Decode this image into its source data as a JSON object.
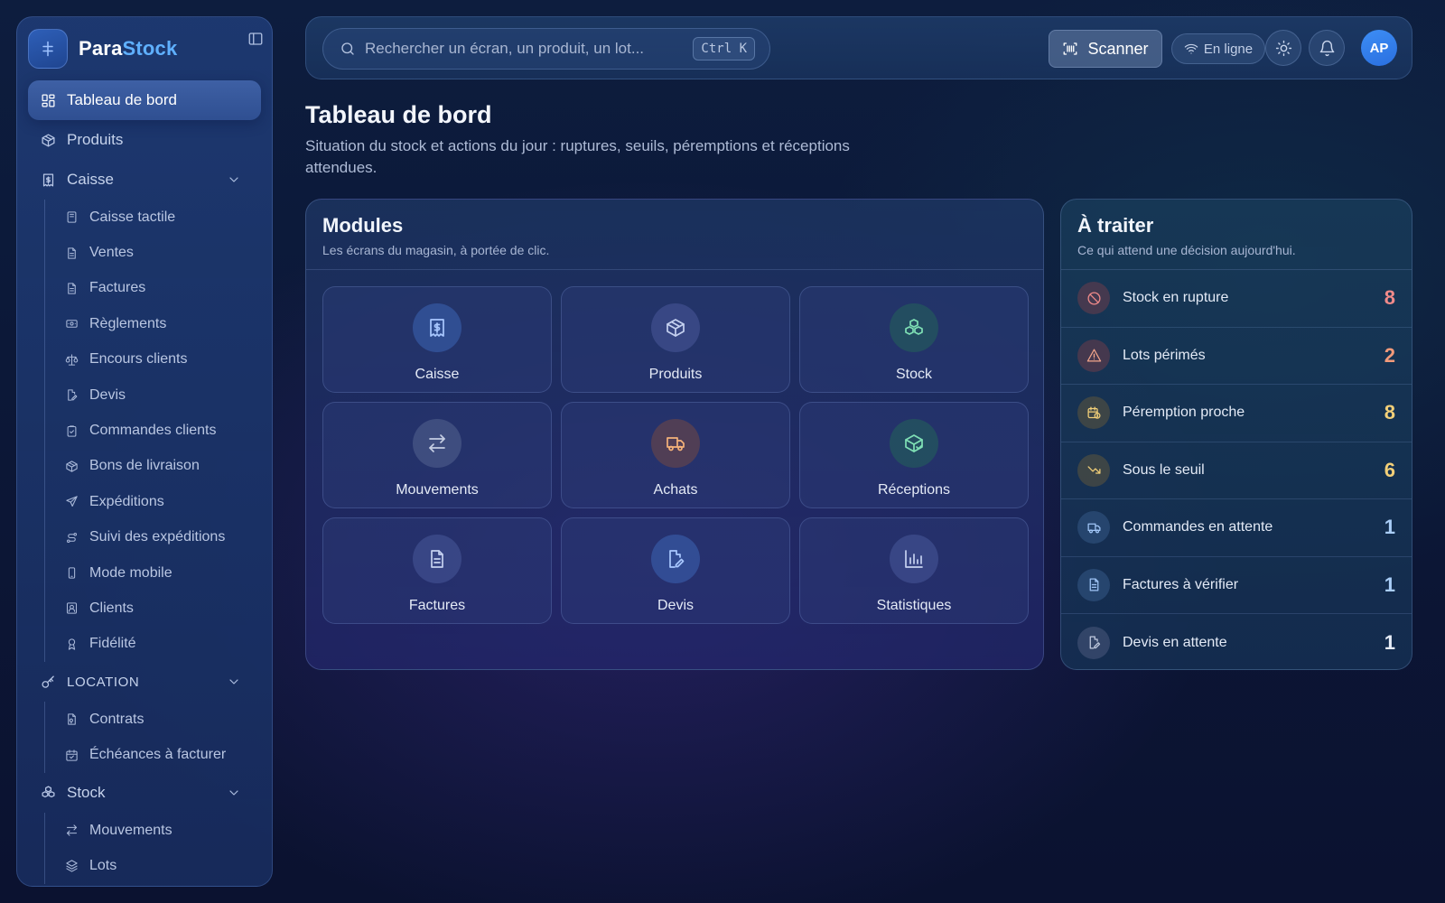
{
  "brand": {
    "name_part1": "Para",
    "name_part2": "Stock"
  },
  "sidebar": {
    "dashboard": "Tableau de bord",
    "products": "Produits",
    "caisse": {
      "label": "Caisse",
      "items": [
        "Caisse tactile",
        "Ventes",
        "Factures",
        "Règlements",
        "Encours clients",
        "Devis",
        "Commandes clients",
        "Bons de livraison",
        "Expéditions",
        "Suivi des expéditions",
        "Mode mobile",
        "Clients",
        "Fidélité"
      ]
    },
    "location": {
      "label": "LOCATION",
      "items": [
        "Contrats",
        "Échéances à facturer"
      ]
    },
    "stock": {
      "label": "Stock",
      "items": [
        "Mouvements",
        "Lots"
      ]
    }
  },
  "topbar": {
    "search_placeholder": "Rechercher un écran, un produit, un lot...",
    "shortcut": "Ctrl K",
    "scan_label": "Scanner",
    "status_label": "En ligne",
    "avatar_initials": "AP"
  },
  "header": {
    "title": "Tableau de bord",
    "subtitle": "Situation du stock et actions du jour : ruptures, seuils, péremptions et réceptions attendues."
  },
  "modules": {
    "title": "Modules",
    "subtitle": "Les écrans du magasin, à portée de clic.",
    "tiles": [
      {
        "label": "Caisse",
        "icon": "receipt-dollar-icon"
      },
      {
        "label": "Produits",
        "icon": "package-icon"
      },
      {
        "label": "Stock",
        "icon": "boxes-icon"
      },
      {
        "label": "Mouvements",
        "icon": "arrows-swap-icon"
      },
      {
        "label": "Achats",
        "icon": "truck-icon"
      },
      {
        "label": "Réceptions",
        "icon": "package-check-icon"
      },
      {
        "label": "Factures",
        "icon": "file-text-icon"
      },
      {
        "label": "Devis",
        "icon": "file-edit-icon"
      },
      {
        "label": "Statistiques",
        "icon": "bar-chart-icon"
      }
    ]
  },
  "todo": {
    "title": "À traiter",
    "subtitle": "Ce qui attend une décision aujourd'hui.",
    "rows": [
      {
        "label": "Stock en rupture",
        "count": "8",
        "color": "#f08a8a",
        "icon": "ban-icon"
      },
      {
        "label": "Lots périmés",
        "count": "2",
        "color": "#f29a7a",
        "icon": "warning-icon"
      },
      {
        "label": "Péremption proche",
        "count": "8",
        "color": "#f2cf78",
        "icon": "calendar-clock-icon"
      },
      {
        "label": "Sous le seuil",
        "count": "6",
        "color": "#f2cf78",
        "icon": "trending-down-icon"
      },
      {
        "label": "Commandes en attente",
        "count": "1",
        "color": "#a9cdf7",
        "icon": "truck-icon"
      },
      {
        "label": "Factures à vérifier",
        "count": "1",
        "color": "#a9cdf7",
        "icon": "file-text-icon"
      },
      {
        "label": "Devis en attente",
        "count": "1",
        "color": "#e6ecf7",
        "icon": "file-edit-icon"
      }
    ]
  }
}
